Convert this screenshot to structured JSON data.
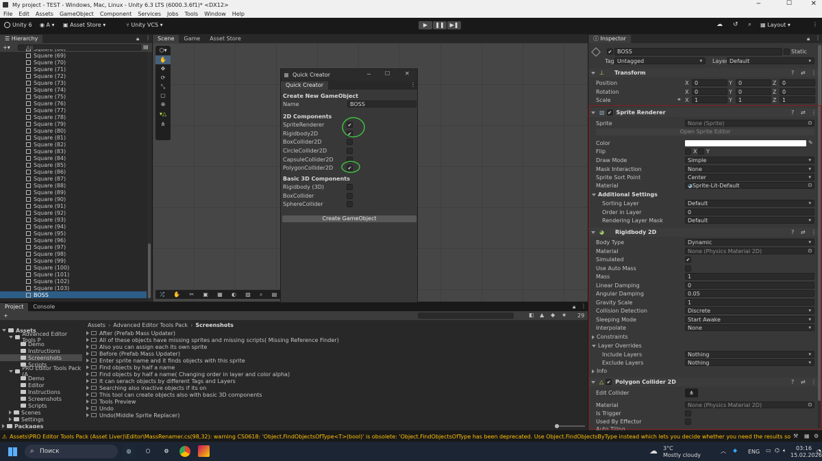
{
  "window": {
    "title": "My project - TEST - Windows, Mac, Linux - Unity 6.3 LTS (6000.3.6f1)* <DX12>"
  },
  "menu": [
    "File",
    "Edit",
    "Assets",
    "GameObject",
    "Component",
    "Services",
    "Jobs",
    "Tools",
    "Window",
    "Help"
  ],
  "toolbar": {
    "unity_label": "Unity 6",
    "account_label": "A",
    "asset_store_label": "Asset Store",
    "vcs_label": "Unity VCS",
    "layout_label": "Layout"
  },
  "hierarchy": {
    "tab": "Hierarchy",
    "search_placeholder": "All",
    "items": [
      "Square (68)",
      "Square (69)",
      "Square (70)",
      "Square (71)",
      "Square (72)",
      "Square (73)",
      "Square (74)",
      "Square (75)",
      "Square (76)",
      "Square (77)",
      "Square (78)",
      "Square (79)",
      "Square (80)",
      "Square (81)",
      "Square (82)",
      "Square (83)",
      "Square (84)",
      "Square (85)",
      "Square (86)",
      "Square (87)",
      "Square (88)",
      "Square (89)",
      "Square (90)",
      "Square (91)",
      "Square (92)",
      "Square (93)",
      "Square (94)",
      "Square (95)",
      "Square (96)",
      "Square (97)",
      "Square (98)",
      "Square (99)",
      "Square (100)",
      "Square (101)",
      "Square (102)",
      "Square (103)",
      "BOSS"
    ],
    "selected": "BOSS"
  },
  "scene_tabs": [
    {
      "label": "Scene",
      "active": true
    },
    {
      "label": "Game",
      "active": false
    },
    {
      "label": "Asset Store",
      "active": false
    }
  ],
  "quick_creator": {
    "title": "Quick Creator",
    "tab": "Quick Creator",
    "create_header": "Create New GameObject",
    "name_label": "Name",
    "name_value": "BOSS",
    "section_2d": "2D Components",
    "items_2d": [
      {
        "label": "SpriteRenderer",
        "checked": true
      },
      {
        "label": "Rigidbody2D",
        "checked": true
      },
      {
        "label": "BoxCollider2D",
        "checked": false
      },
      {
        "label": "CircleCollider2D",
        "checked": false
      },
      {
        "label": "CapsuleCollider2D",
        "checked": false
      },
      {
        "label": "PolygonCollider2D",
        "checked": true
      }
    ],
    "section_3d": "Basic 3D Components",
    "items_3d": [
      {
        "label": "Rigidbody (3D)",
        "checked": false
      },
      {
        "label": "BoxCollider",
        "checked": false
      },
      {
        "label": "SphereCollider",
        "checked": false
      }
    ],
    "create_button": "Create GameObject"
  },
  "project": {
    "tabs": [
      {
        "label": "Project",
        "active": true
      },
      {
        "label": "Console",
        "active": false
      }
    ],
    "breadcrumb": [
      "Assets",
      "Advanced Editor Tools Pack",
      "Screenshots"
    ],
    "count": "29",
    "tree": [
      {
        "label": "Assets",
        "depth": 0,
        "open": true
      },
      {
        "label": "Advanced Editor Tools P",
        "depth": 1,
        "open": true
      },
      {
        "label": "Demo",
        "depth": 2
      },
      {
        "label": "Instructions",
        "depth": 2
      },
      {
        "label": "Screenshots",
        "depth": 2,
        "selected": true
      },
      {
        "label": "Scripts",
        "depth": 2
      },
      {
        "label": "PRO Editor Tools Pack (A",
        "depth": 1,
        "open": true
      },
      {
        "label": "Demo",
        "depth": 2
      },
      {
        "label": "Editor",
        "depth": 2
      },
      {
        "label": "Instructions",
        "depth": 2
      },
      {
        "label": "Screenshots",
        "depth": 2
      },
      {
        "label": "Scripts",
        "depth": 2
      },
      {
        "label": "Scenes",
        "depth": 1
      },
      {
        "label": "Settings",
        "depth": 1
      },
      {
        "label": "Packages",
        "depth": 0
      }
    ],
    "files": [
      "After (Prefab Mass Updater)",
      "All of these objects have missing sprites and missing scripts( Missing Reference Finder)",
      "Also you can assign each its own sprite",
      "Before (Prefab Mass Updater)",
      "Enter sprite name and it finds objects with this sprite",
      "Find objects by half a name",
      "Find objects by half a name( Changing order in layer and color alpha)",
      "It can serach objects by different Tags and Layers",
      "Searching also inactive objects if its on",
      "This tool can create objects also with basic 3D components",
      "Tools Preview",
      "Undo",
      "Undo(Middle Sprite Replacer)"
    ]
  },
  "inspector": {
    "tab": "Inspector",
    "object_name": "BOSS",
    "static_label": "Static",
    "tag_label": "Tag",
    "tag_value": "Untagged",
    "layer_label": "Layer",
    "layer_value": "Default",
    "transform": {
      "title": "Transform",
      "rows": [
        {
          "label": "Position",
          "x": "0",
          "y": "0",
          "z": "0"
        },
        {
          "label": "Rotation",
          "x": "0",
          "y": "0",
          "z": "0"
        },
        {
          "label": "Scale",
          "x": "1",
          "y": "1",
          "z": "1"
        }
      ]
    },
    "sprite_renderer": {
      "title": "Sprite Renderer",
      "sprite_label": "Sprite",
      "sprite_value": "None (Sprite)",
      "open_editor": "Open Sprite Editor",
      "color_label": "Color",
      "flip_label": "Flip",
      "flip_x": "X",
      "flip_y": "Y",
      "rows": [
        {
          "label": "Draw Mode",
          "value": "Simple"
        },
        {
          "label": "Mask Interaction",
          "value": "None"
        },
        {
          "label": "Sprite Sort Point",
          "value": "Center"
        }
      ],
      "material_label": "Material",
      "material_value": "Sprite-Lit-Default",
      "additional": "Additional Settings",
      "sub_rows": [
        {
          "label": "Sorting Layer",
          "value": "Default",
          "dd": true
        },
        {
          "label": "Order in Layer",
          "value": "0",
          "dd": false
        },
        {
          "label": "Rendering Layer Mask",
          "value": "Default",
          "dd": true
        }
      ]
    },
    "rigidbody": {
      "title": "Rigidbody 2D",
      "rows": [
        {
          "label": "Body Type",
          "value": "Dynamic",
          "kind": "dd"
        },
        {
          "label": "Material",
          "value": "None (Physics Material 2D)",
          "kind": "obj"
        },
        {
          "label": "Simulated",
          "value": "✔",
          "kind": "chk"
        },
        {
          "label": "Use Auto Mass",
          "value": "",
          "kind": "chk"
        },
        {
          "label": "Mass",
          "value": "1",
          "kind": "num"
        },
        {
          "label": "Linear Damping",
          "value": "0",
          "kind": "num"
        },
        {
          "label": "Angular Damping",
          "value": "0.05",
          "kind": "num"
        },
        {
          "label": "Gravity Scale",
          "value": "1",
          "kind": "num"
        },
        {
          "label": "Collision Detection",
          "value": "Discrete",
          "kind": "dd"
        },
        {
          "label": "Sleeping Mode",
          "value": "Start Awake",
          "kind": "dd"
        },
        {
          "label": "Interpolate",
          "value": "None",
          "kind": "dd"
        }
      ],
      "constraints": "Constraints",
      "overrides": "Layer Overrides",
      "include_label": "Include Layers",
      "include_value": "Nothing",
      "exclude_label": "Exclude Layers",
      "exclude_value": "Nothing",
      "info": "Info"
    },
    "polygon": {
      "title": "Polygon Collider 2D",
      "edit_label": "Edit Collider",
      "material_label": "Material",
      "material_value": "None (Physics Material 2D)",
      "trigger_label": "Is Trigger",
      "effector_label": "Used By Effector",
      "tiling_label": "Auto Tiling"
    }
  },
  "status": {
    "message": "Assets\\PRO Editor Tools Pack (Asset Liver)\\Editor\\MassRenamer.cs(98,32): warning CS0618: 'Object.FindObjectsOfType<T>(bool)' is obsolete: 'Object.FindObjectsOfType has been deprecated. Use Object.FindObjectsByType instead which lets you decide whether you need the results sorted or not.  FindObjectsOf"
  },
  "taskbar": {
    "search_label": "Поиск",
    "weather_temp": "3°C",
    "weather_text": "Mostly cloudy",
    "lang": "ENG",
    "time": "03:16",
    "date": "15.02.2026"
  },
  "colors": {
    "accent": "#2c5d87",
    "warning": "#ffc107",
    "highlight_red": "#8b1a1a",
    "circle_green": "#3fbf3f"
  }
}
